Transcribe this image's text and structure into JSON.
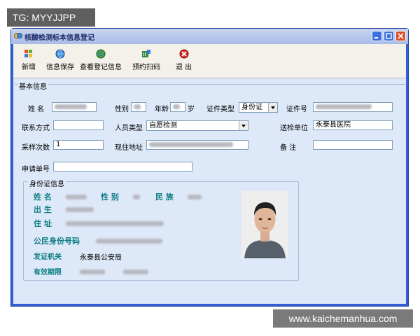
{
  "watermarks": {
    "top_left": "TG: MYYJJPP",
    "bottom_right": "www.kaichemanhua.com"
  },
  "window": {
    "title": "核酸检测标本信息登记"
  },
  "toolbar": {
    "new": "新增",
    "save_info": "信息保存",
    "view_registry": "查看登记信息",
    "scan": "预约扫码",
    "exit": "退 出"
  },
  "basic_info": {
    "title": "基本信息",
    "name_label": "姓  名",
    "gender_label": "性别",
    "age_label": "年龄",
    "age_unit": "岁",
    "id_type_label": "证件类型",
    "id_type_value": "身份证",
    "id_no_label": "证件号",
    "contact_label": "联系方式",
    "person_type_label": "人员类型",
    "person_type_value": "自愿检测",
    "lab_label": "送检单位",
    "lab_value": "永泰县医院",
    "sample_count_label": "采样次数",
    "sample_count_value": "1",
    "address_label": "现住地址",
    "remark_label": "备  注",
    "request_no_label": "申请单号"
  },
  "id_card": {
    "title": "身份证信息",
    "name_label": "姓  名",
    "gender_label": "性  别",
    "ethnicity_label": "民  族",
    "birth_label": "出  生",
    "address_label": "住  址",
    "id_number_label": "公民身份号码",
    "issuer_label": "发证机关",
    "issuer_value": "永泰县公安局",
    "validity_label": "有效期限"
  }
}
